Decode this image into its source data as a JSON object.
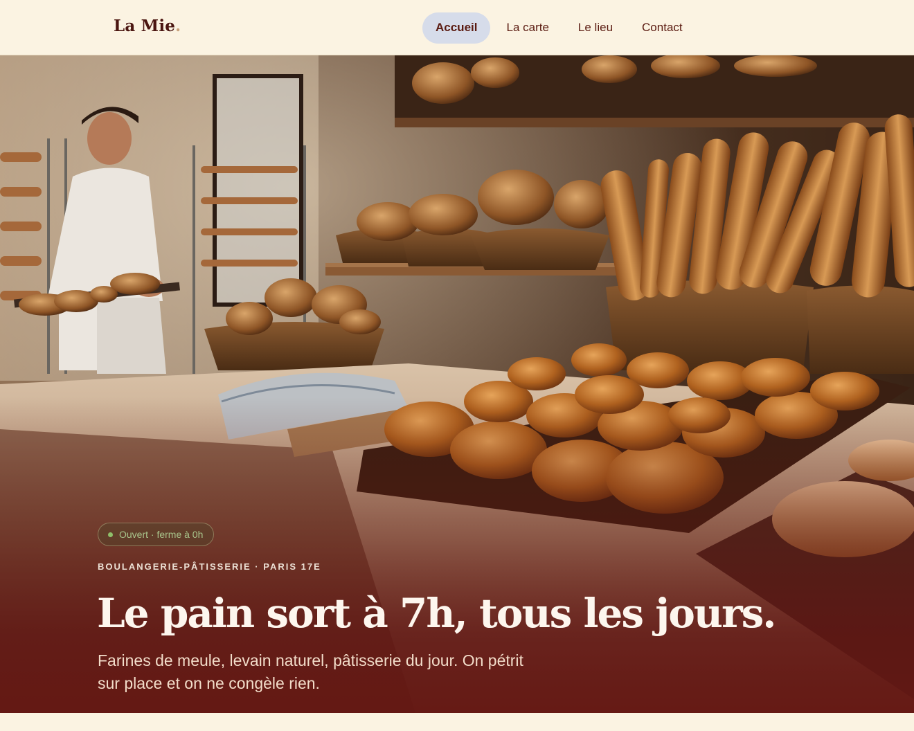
{
  "brand": {
    "name": "La Mie",
    "dot": "."
  },
  "nav": {
    "items": [
      {
        "label": "Accueil",
        "active": true
      },
      {
        "label": "La carte",
        "active": false
      },
      {
        "label": "Le lieu",
        "active": false
      },
      {
        "label": "Contact",
        "active": false
      }
    ]
  },
  "hero": {
    "status": "Ouvert · ferme à 0h",
    "eyebrow": "BOULANGERIE-PÂTISSERIE · PARIS 17E",
    "title": "Le pain sort à 7h, tous les jours.",
    "subtitle_line1": "Farines de meule, levain naturel, pâtisserie du jour. On pétrit",
    "subtitle_line2": "sur place et on ne congèle rien.",
    "image": "bakery-interior-photo"
  },
  "colors": {
    "background": "#fbf3e2",
    "brand_text": "#4a1510",
    "nav_active_bg": "#d6dcea",
    "status_green": "#8fbf6a",
    "hero_overlay": "#641612"
  }
}
